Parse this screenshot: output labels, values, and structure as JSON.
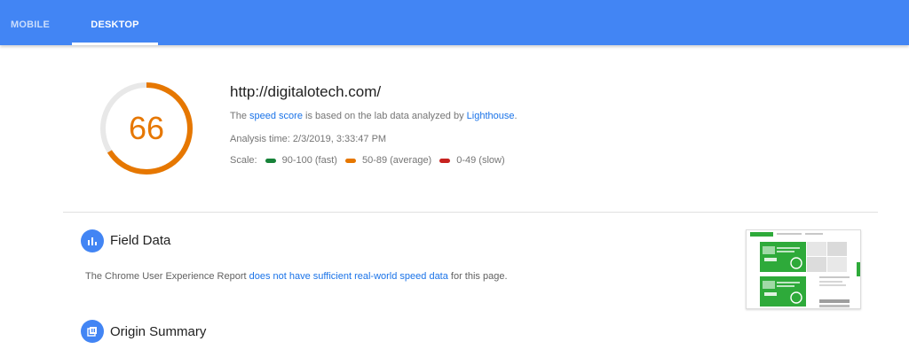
{
  "tabs": [
    {
      "label": "MOBILE",
      "active": false
    },
    {
      "label": "DESKTOP",
      "active": true
    }
  ],
  "score": {
    "value": 66,
    "fraction": 0.66,
    "color": "#e67700",
    "track_color": "#e8e8e8"
  },
  "page": {
    "url": "http://digitalotech.com/",
    "desc_prefix": "The ",
    "desc_link_1": "speed score",
    "desc_middle": " is based on the lab data analyzed by ",
    "desc_link_2": "Lighthouse",
    "desc_suffix": ".",
    "analysis_time": "Analysis time: 2/3/2019, 3:33:47 PM"
  },
  "scale": {
    "label": "Scale:",
    "fast": "90-100 (fast)",
    "average": "50-89 (average)",
    "slow": "0-49 (slow)",
    "colors": {
      "fast": "#178239",
      "average": "#e67700",
      "slow": "#c7221f"
    }
  },
  "field_data": {
    "title": "Field Data",
    "icon": "bar-chart-icon",
    "text_prefix": "The Chrome User Experience Report ",
    "text_link": "does not have sufficient real-world speed data",
    "text_suffix": " for this page."
  },
  "origin_summary": {
    "title": "Origin Summary",
    "icon": "origin-summary-icon"
  },
  "thumbnail": {
    "image": "page-screenshot-thumbnail",
    "accent": "#2eaa3a"
  }
}
